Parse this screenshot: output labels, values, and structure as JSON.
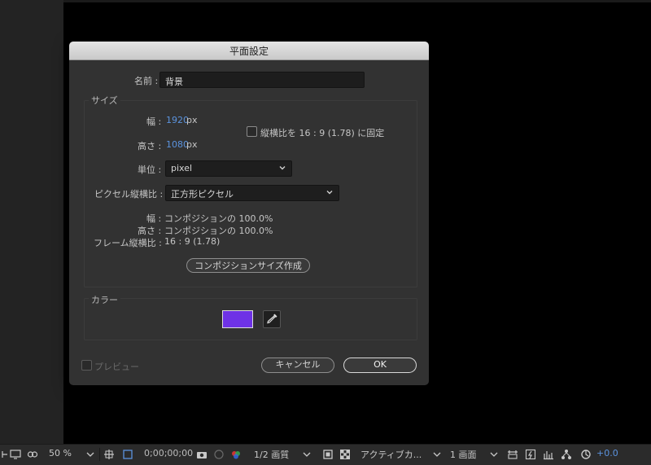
{
  "dialog": {
    "title": "平面設定",
    "name_label": "名前 :",
    "name_value": "背景",
    "size_group_label": "サイズ",
    "width_label": "幅 :",
    "width_value": "1920",
    "width_unit": "px",
    "height_label": "高さ :",
    "height_value": "1080",
    "height_unit": "px",
    "lock_aspect_label": "縦横比を 16 : 9 (1.78) に固定",
    "lock_aspect_checked": false,
    "units_label": "単位 :",
    "units_value": "pixel",
    "pixel_aspect_label": "ピクセル縦横比 :",
    "pixel_aspect_value": "正方形ピクセル",
    "info_width_label": "幅 :",
    "info_width_value": "コンポジションの 100.0%",
    "info_height_label": "高さ :",
    "info_height_value": "コンポジションの 100.0%",
    "info_frame_label": "フレーム縦横比 :",
    "info_frame_value": "16 : 9 (1.78)",
    "make_comp_size_button": "コンポジションサイズ作成",
    "color_group_label": "カラー",
    "color_value": "#6e32e6",
    "preview_label": "プレビュー",
    "cancel_button": "キャンセル",
    "ok_button": "OK"
  },
  "toolbar": {
    "zoom": "50 %",
    "timecode": "0;00;00;00",
    "resolution": "1/2 画質",
    "camera": "アクティブカ...",
    "views": "1 画面",
    "exposure": "+0.0",
    "exposure_color": "#5b93de"
  }
}
